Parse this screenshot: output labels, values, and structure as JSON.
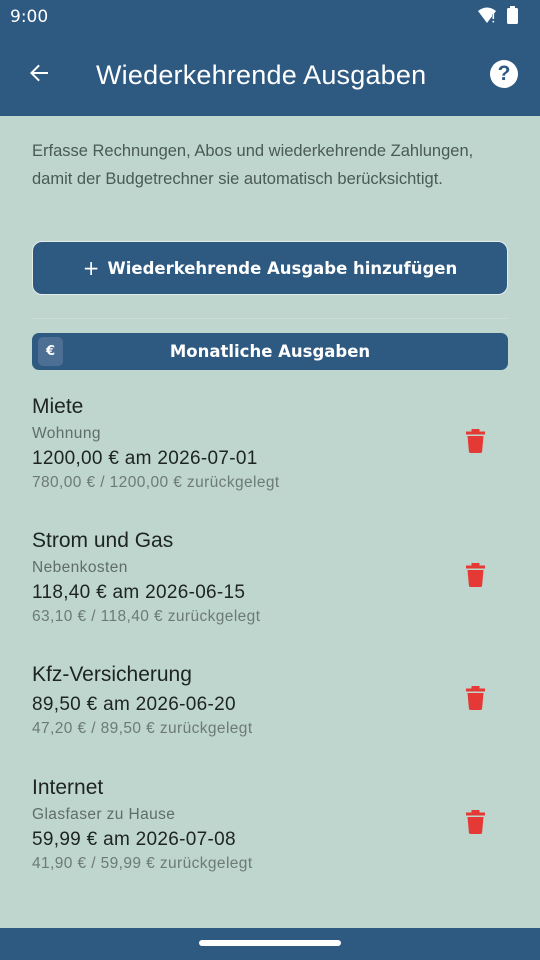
{
  "status_bar": {
    "time": "9:00",
    "icons": [
      "wifi-alert-icon",
      "battery-icon"
    ]
  },
  "app_bar": {
    "title": "Wiederkehrende Ausgaben",
    "back_icon": "arrow-left-icon",
    "help_icon": "help-circle-icon",
    "help_glyph": "?"
  },
  "intro_text": "Erfasse Rechnungen, Abos und wiederkehrende Zahlungen, damit der Budgetrechner sie automatisch berücksichtigt.",
  "add_button": {
    "plus": "+",
    "label": "Wiederkehrende Ausgabe hinzufügen"
  },
  "section": {
    "badge": "€",
    "title": "Monatliche Ausgaben"
  },
  "expenses": [
    {
      "name": "Miete",
      "category": "Wohnung",
      "amount": "1200,00 € am 2026-07-01",
      "saved": "780,00 € / 1200,00 € zurückgelegt"
    },
    {
      "name": "Strom und Gas",
      "category": "Nebenkosten",
      "amount": "118,40 € am 2026-06-15",
      "saved": "63,10 € / 118,40 € zurückgelegt"
    },
    {
      "name": "Kfz-Versicherung",
      "category": "",
      "amount": "89,50 € am 2026-06-20",
      "saved": "47,20 € / 89,50 € zurückgelegt"
    },
    {
      "name": "Internet",
      "category": "Glasfaser zu Hause",
      "amount": "59,99 € am 2026-07-08",
      "saved": "41,90 € / 59,99 € zurückgelegt"
    }
  ],
  "colors": {
    "primary": "#2e5a82",
    "background": "#bed6cd",
    "delete": "#e53935"
  }
}
